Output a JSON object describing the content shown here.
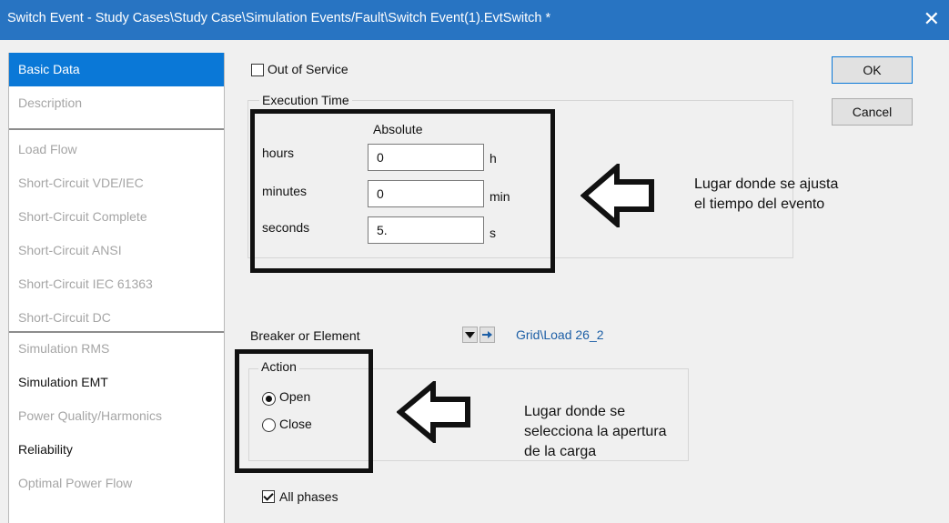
{
  "window": {
    "title": "Switch Event - Study Cases\\Study Case\\Simulation Events/Fault\\Switch Event(1).EvtSwitch *",
    "close_glyph": "✕"
  },
  "sidebar": {
    "items": [
      {
        "label": "Basic Data"
      },
      {
        "label": "Description"
      },
      {
        "label": "Load Flow"
      },
      {
        "label": "Short-Circuit VDE/IEC"
      },
      {
        "label": "Short-Circuit Complete"
      },
      {
        "label": "Short-Circuit ANSI"
      },
      {
        "label": "Short-Circuit IEC 61363"
      },
      {
        "label": "Short-Circuit DC"
      },
      {
        "label": "Simulation RMS"
      },
      {
        "label": "Simulation EMT"
      },
      {
        "label": "Power Quality/Harmonics"
      },
      {
        "label": "Reliability"
      },
      {
        "label": "Optimal Power Flow"
      }
    ]
  },
  "form": {
    "out_of_service": "Out of Service",
    "execution_time": {
      "group_label": "Execution Time",
      "column_header": "Absolute",
      "hours": {
        "label": "hours",
        "value": "0",
        "unit": "h"
      },
      "minutes": {
        "label": "minutes",
        "value": "0",
        "unit": "min"
      },
      "seconds": {
        "label": "seconds",
        "value": "5.",
        "unit": "s"
      }
    },
    "breaker": {
      "label": "Breaker or Element",
      "value": "Grid\\Load 26_2"
    },
    "action": {
      "group_label": "Action",
      "open": "Open",
      "close": "Close",
      "selected": "Open"
    },
    "all_phases": "All phases"
  },
  "buttons": {
    "ok": "OK",
    "cancel": "Cancel"
  },
  "annotations": {
    "time_note": [
      "Lugar donde se ajusta",
      "el tiempo del evento"
    ],
    "action_note": [
      "Lugar donde se",
      "selecciona la apertura",
      "de la carga"
    ]
  }
}
